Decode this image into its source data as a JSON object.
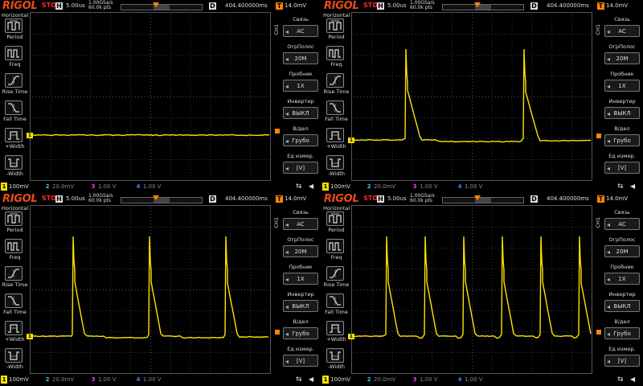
{
  "common": {
    "logo": "RIGOL",
    "run_state": "STOP",
    "h_label": "H",
    "timebase": "5.00us",
    "sample_rate": "1.00GSa/s",
    "mem_depth": "60.0k pts",
    "d_label": "D",
    "delay": "404.400000ms",
    "t_label": "T",
    "trigger_level": "14.0mV",
    "ch1_vertical_label": "CH1",
    "left_menu_title": "Horizontal",
    "left_items": [
      "Period",
      "Freq",
      "Rise Time",
      "Fall Time",
      "+Width",
      "-Width"
    ],
    "right_items": [
      {
        "title": "Связь",
        "value": "AC"
      },
      {
        "title": "ОгрПолос",
        "value": "20M"
      },
      {
        "title": "Пробник",
        "value": "1X"
      },
      {
        "title": "Инвертир",
        "value": "ВЫКЛ"
      },
      {
        "title": "В/дел",
        "value": "Грубо"
      },
      {
        "title": "Ед измер.",
        "value": "[V]"
      }
    ],
    "channels": [
      {
        "num": "1",
        "value": "100mV"
      },
      {
        "num": "2",
        "value": "20.0mV"
      },
      {
        "num": "3",
        "value": "1.00 V"
      },
      {
        "num": "4",
        "value": "1.00 V"
      }
    ],
    "colors": {
      "ch1": "#ffe200",
      "trigger": "#ff8800",
      "logo": "#e84c1a",
      "stop": "#ff2a2a"
    },
    "icons": {
      "usb": "usb-icon",
      "speaker": "speaker-icon"
    }
  },
  "panels": [
    {
      "id": "p1",
      "pulses": 0
    },
    {
      "id": "p2",
      "pulses": 2
    },
    {
      "id": "p3",
      "pulses": 3
    },
    {
      "id": "p4",
      "pulses": 5
    }
  ]
}
